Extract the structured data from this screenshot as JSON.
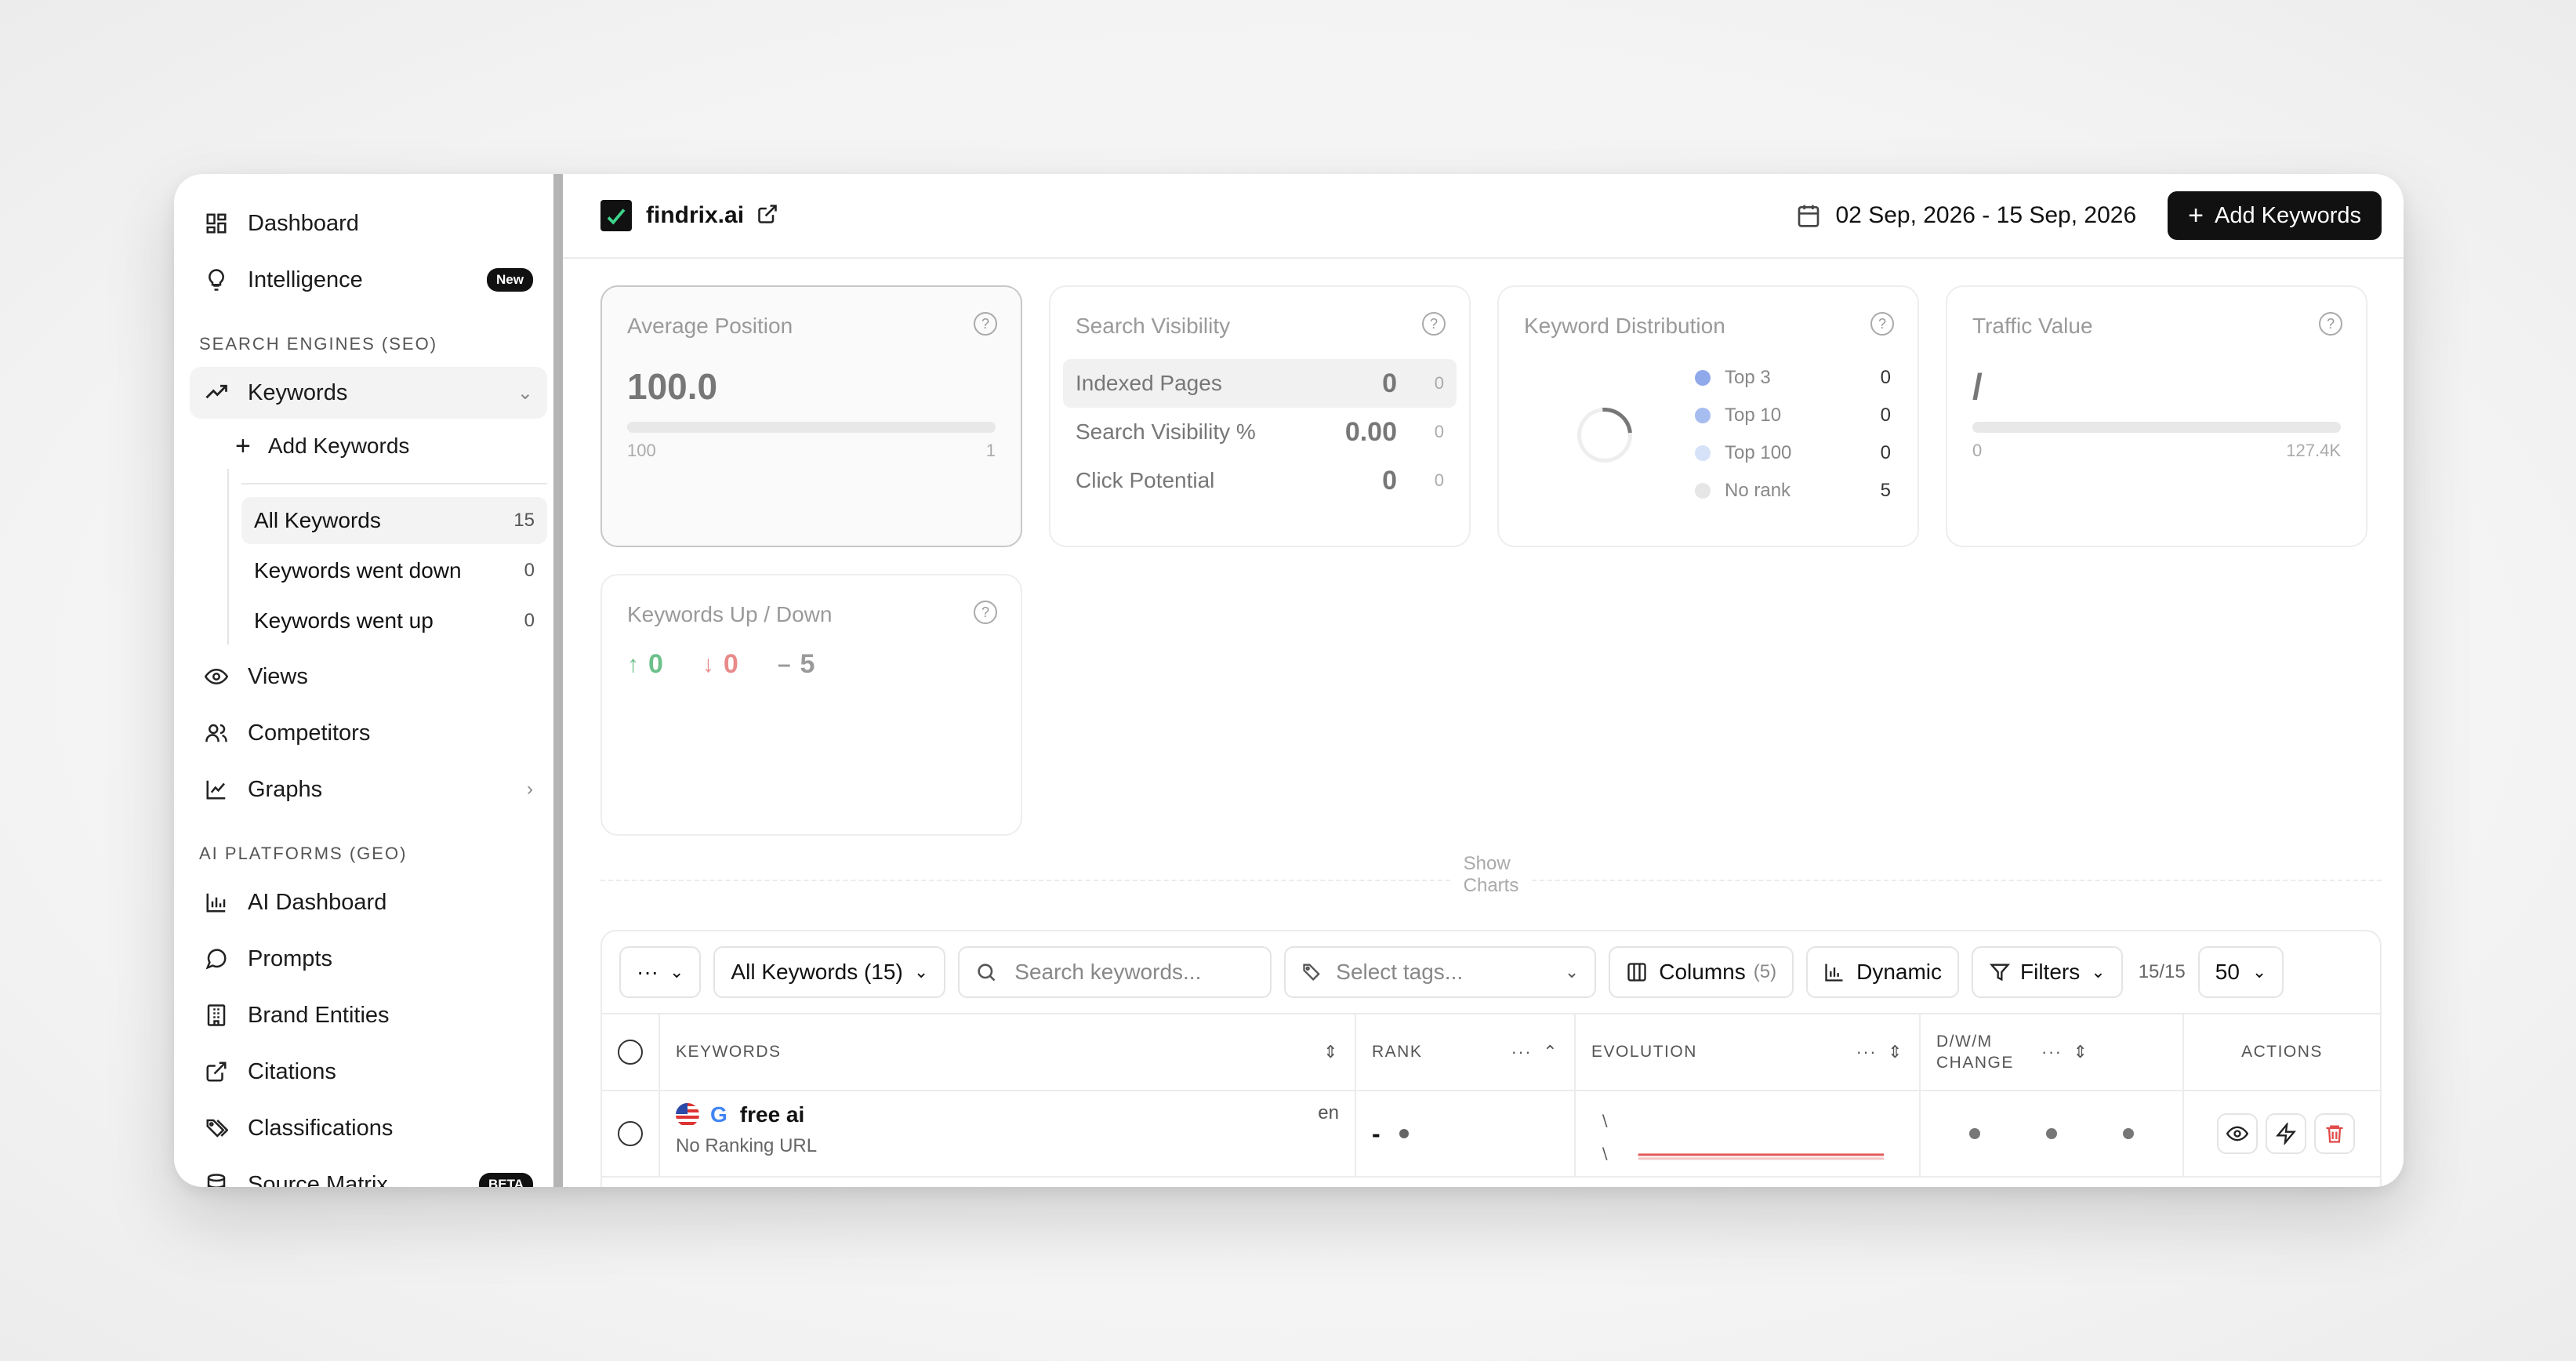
{
  "sidebar": {
    "top_items": [
      {
        "label": "Dashboard",
        "icon": "dashboard-icon"
      },
      {
        "label": "Intelligence",
        "icon": "lightbulb-icon",
        "badge": "New"
      }
    ],
    "seo_section": "SEARCH ENGINES (SEO)",
    "keywords": {
      "label": "Keywords",
      "add_label": "Add Keywords",
      "sub_items": [
        {
          "label": "All Keywords",
          "count": "15"
        },
        {
          "label": "Keywords went down",
          "count": "0"
        },
        {
          "label": "Keywords went up",
          "count": "0"
        }
      ]
    },
    "seo_items": [
      {
        "label": "Views"
      },
      {
        "label": "Competitors"
      },
      {
        "label": "Graphs"
      }
    ],
    "geo_section": "AI PLATFORMS (GEO)",
    "geo_items": [
      {
        "label": "AI Dashboard"
      },
      {
        "label": "Prompts"
      },
      {
        "label": "Brand Entities"
      },
      {
        "label": "Citations"
      },
      {
        "label": "Classifications"
      },
      {
        "label": "Source Matrix",
        "badge": "BETA"
      }
    ]
  },
  "header": {
    "site": "findrix.ai",
    "date_range": "02 Sep, 2026 - 15 Sep, 2026",
    "add_keywords": "Add Keywords"
  },
  "cards": {
    "avg_position": {
      "title": "Average Position",
      "value": "100.0",
      "min": "100",
      "max": "1",
      "help": "?"
    },
    "search_visibility": {
      "title": "Search Visibility",
      "rows": [
        {
          "name": "Indexed Pages",
          "value": "0",
          "delta": "0"
        },
        {
          "name": "Search Visibility %",
          "value": "0.00",
          "delta": "0"
        },
        {
          "name": "Click Potential",
          "value": "0",
          "delta": "0"
        }
      ]
    },
    "keyword_distribution": {
      "title": "Keyword Distribution",
      "legend": [
        {
          "name": "Top 3",
          "value": "0",
          "color": "#8fa9ea"
        },
        {
          "name": "Top 10",
          "value": "0",
          "color": "#a7bcef"
        },
        {
          "name": "Top 100",
          "value": "0",
          "color": "#d6e2f8"
        },
        {
          "name": "No rank",
          "value": "5",
          "color": "#e6e6e6"
        }
      ]
    },
    "traffic_value": {
      "title": "Traffic Value",
      "value": "/",
      "min": "0",
      "max": "127.4K"
    },
    "up_down": {
      "title": "Keywords Up / Down",
      "up": "0",
      "down": "0",
      "neutral": "5"
    }
  },
  "show_charts": "Show Charts",
  "toolbar": {
    "more": "···",
    "view_select": "All Keywords (15)",
    "search_placeholder": "Search keywords...",
    "tags_placeholder": "Select tags...",
    "columns": "Columns",
    "columns_count": "(5)",
    "dynamic": "Dynamic",
    "filters": "Filters",
    "count": "15/15",
    "per_page": "50"
  },
  "table": {
    "headers": {
      "keywords": "KEYWORDS",
      "rank": "RANK",
      "evolution": "EVOLUTION",
      "change": "D/W/M CHANGE",
      "actions": "ACTIONS"
    },
    "rows": [
      {
        "keyword": "free ai",
        "lang": "en",
        "url": "No Ranking URL",
        "rank": "-"
      }
    ]
  },
  "colors": {
    "accent_dark": "#111111",
    "up": "#6cc08b",
    "down": "#e88a8a",
    "neutral": "#9a9a9a",
    "danger": "#e14b4b"
  }
}
